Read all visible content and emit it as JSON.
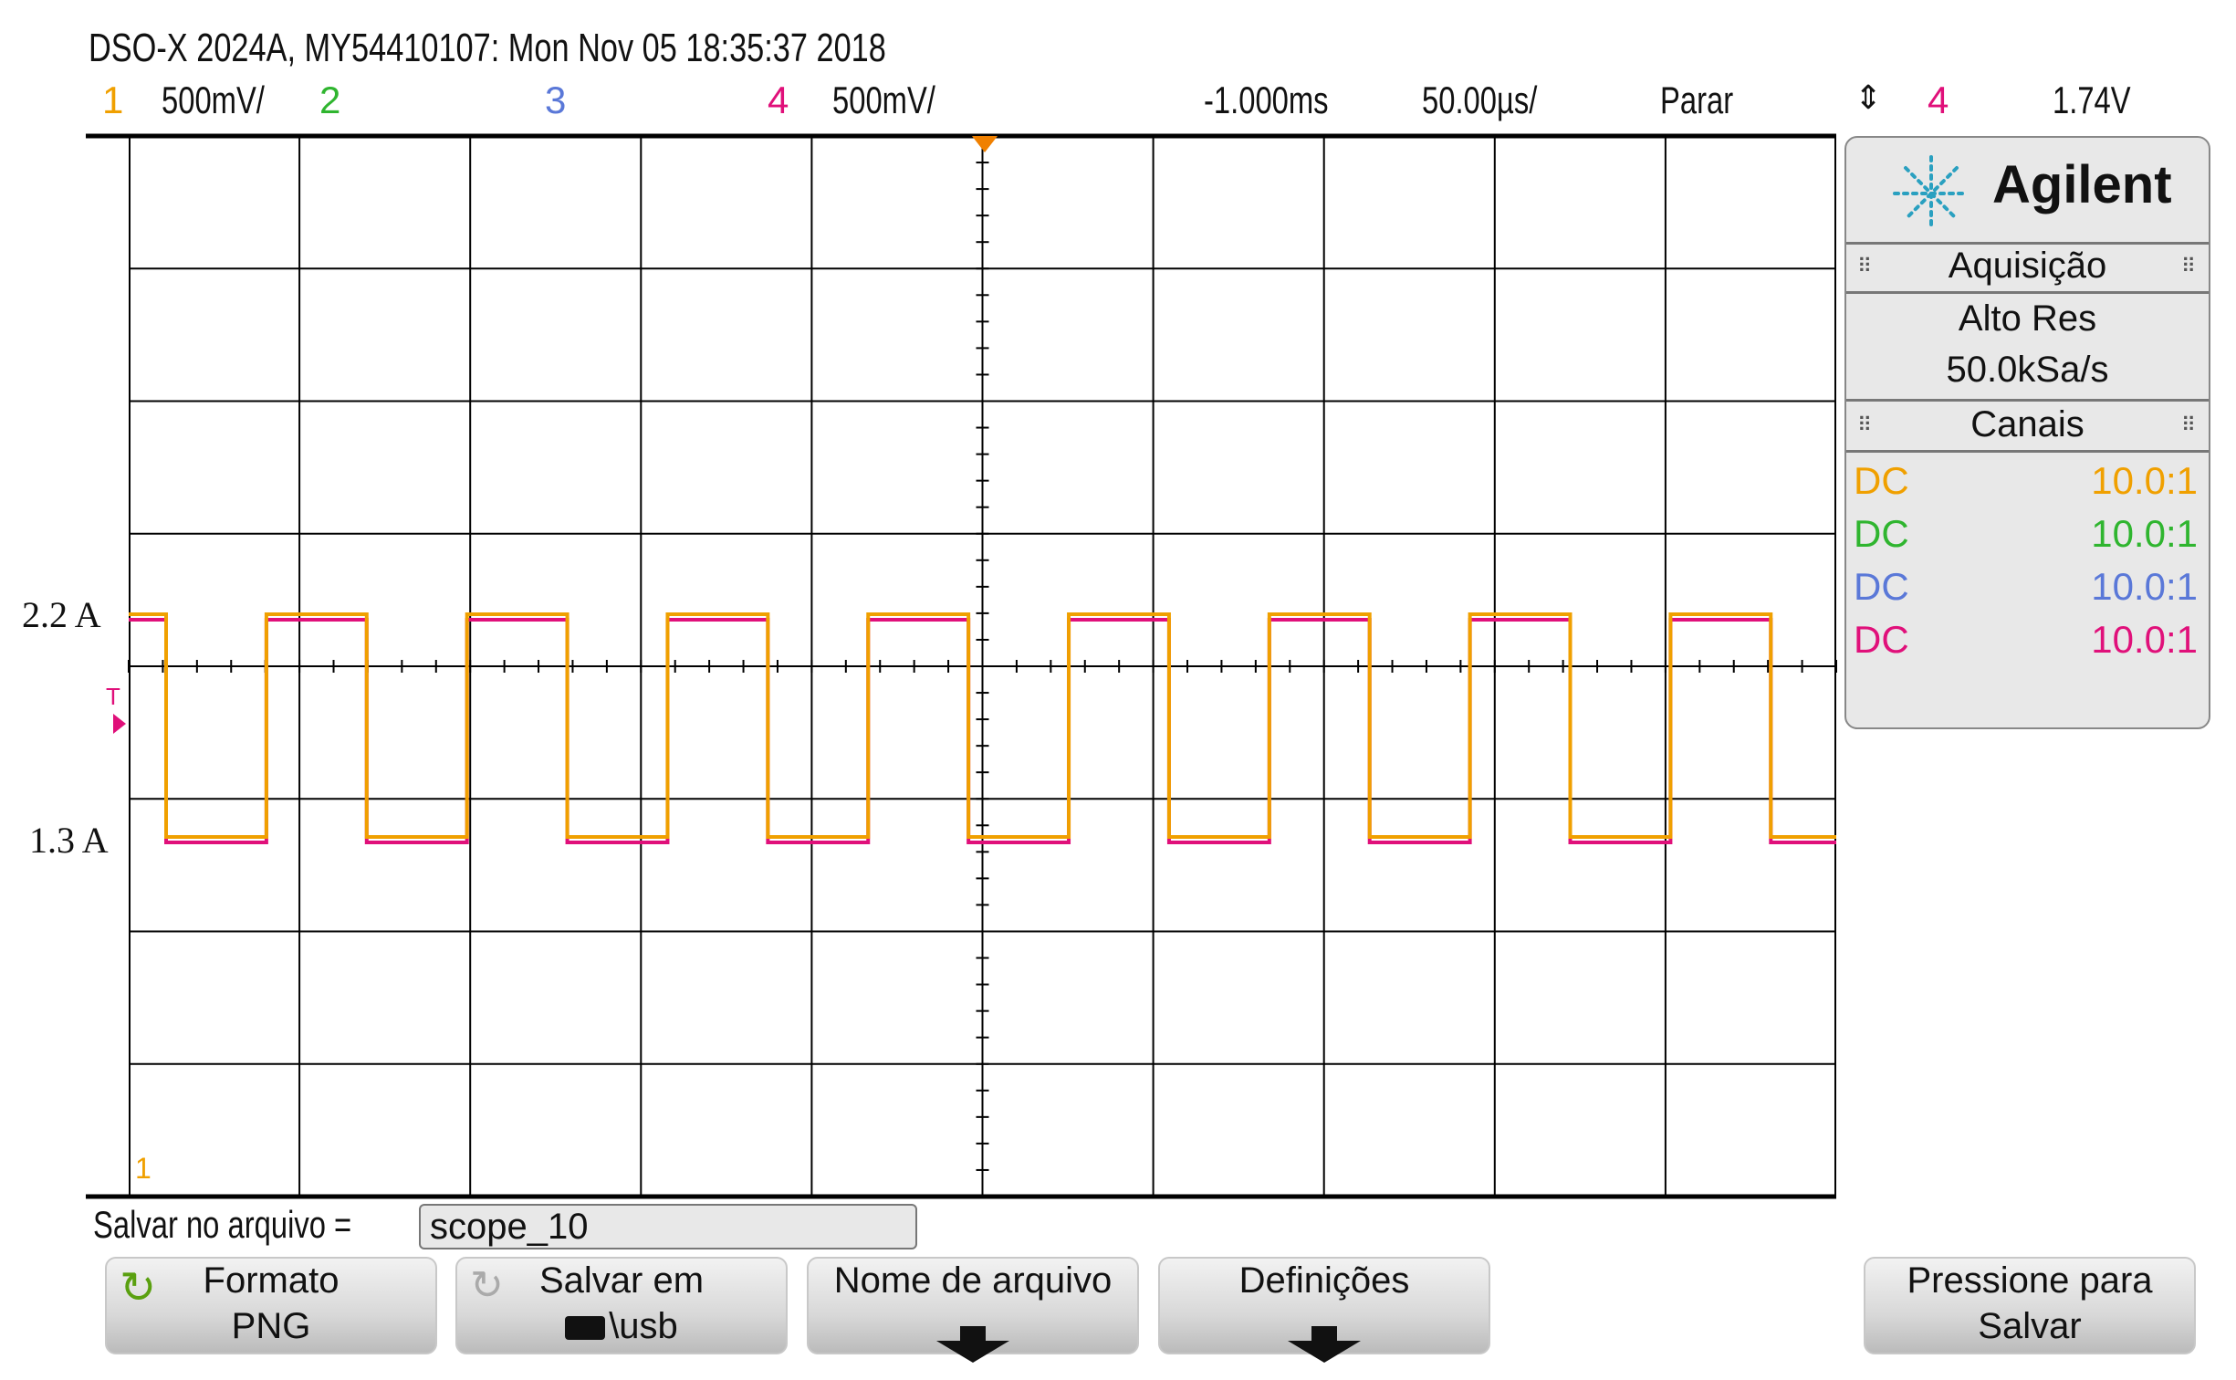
{
  "header": {
    "title": "DSO-X 2024A, MY54410107: Mon Nov 05 18:35:37 2018",
    "channels": [
      {
        "num": "1",
        "scale": "500mV/",
        "color": "#f0a000"
      },
      {
        "num": "2",
        "scale": "",
        "color": "#2fb52f"
      },
      {
        "num": "3",
        "scale": "",
        "color": "#5a78d8"
      },
      {
        "num": "4",
        "scale": "500mV/",
        "color": "#e0107a"
      }
    ],
    "delay": "-1.000ms",
    "timebase": "50.00µs/",
    "run_state": "Parar",
    "trigger_icon": "up-down-arrow-icon",
    "trigger_channel": "4",
    "trigger_level": "1.74V"
  },
  "display": {
    "y_labels": [
      "2.2 A",
      "1.3 A"
    ],
    "trigger_marker": "T",
    "ground_marker": "1",
    "waveform": {
      "high": 2.2,
      "low": 1.3,
      "unit": "A",
      "cycles_visible": 8.5
    }
  },
  "panel": {
    "brand": "Agilent",
    "acquisition_title": "Aquisição",
    "acq_mode": "Alto Res",
    "sample_rate": "50.0kSa/s",
    "channels_title": "Canais",
    "channels": [
      {
        "coupling": "DC",
        "probe": "10.0:1",
        "color": "#f0a000"
      },
      {
        "coupling": "DC",
        "probe": "10.0:1",
        "color": "#2fb52f"
      },
      {
        "coupling": "DC",
        "probe": "10.0:1",
        "color": "#5a78d8"
      },
      {
        "coupling": "DC",
        "probe": "10.0:1",
        "color": "#e0107a"
      }
    ]
  },
  "save": {
    "label": "Salvar no arquivo =",
    "filename": "scope_10"
  },
  "softkeys": [
    {
      "line1": "Formato",
      "line2": "PNG"
    },
    {
      "line1": "Salvar em",
      "line2": "\\usb"
    },
    {
      "line1": "Nome de arquivo"
    },
    {
      "line1": "Definições"
    },
    {
      "line1": "Pressione para",
      "line2": "Salvar"
    }
  ]
}
